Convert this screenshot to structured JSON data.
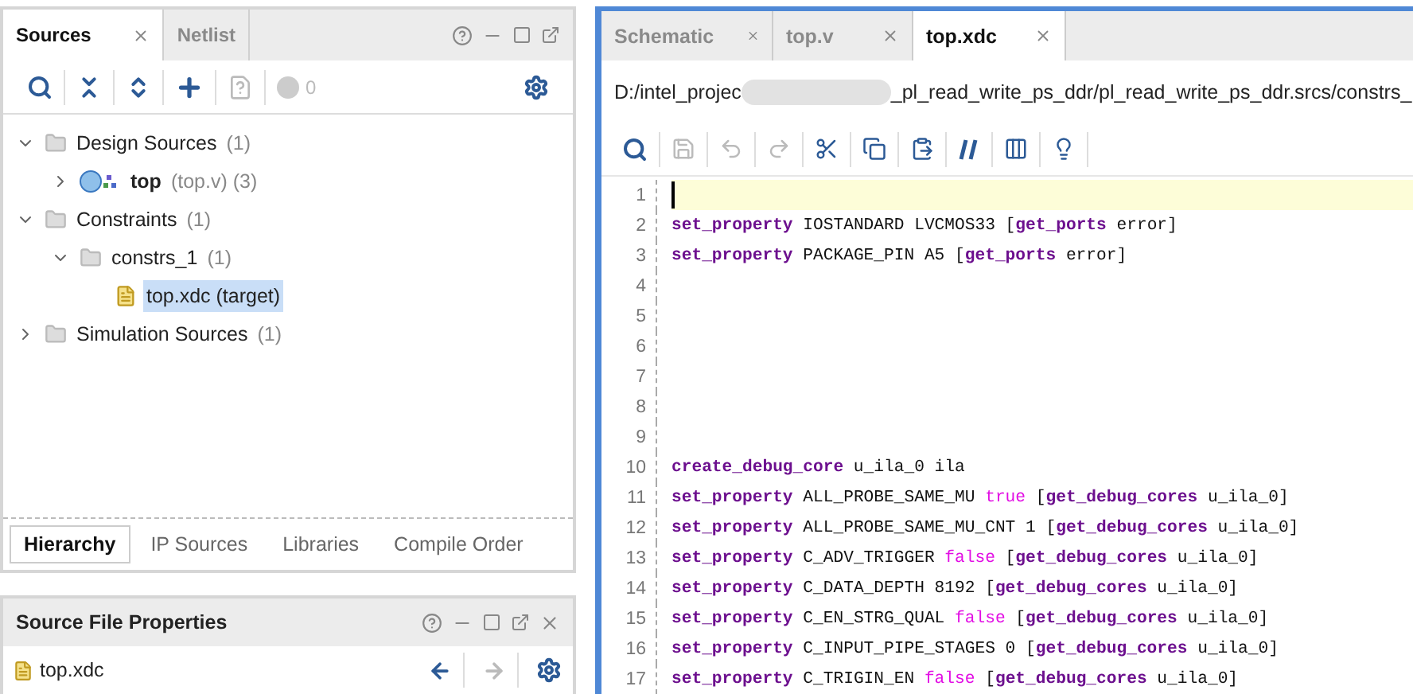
{
  "sources_panel": {
    "tabs": [
      {
        "label": "Sources",
        "selected": true,
        "closable": true
      },
      {
        "label": "Netlist",
        "selected": false,
        "closable": false
      }
    ],
    "issue_count": "0",
    "tree": [
      {
        "kind": "folder",
        "label": "Design Sources",
        "count": "(1)",
        "expanded": true,
        "selected": false,
        "children": [
          {
            "kind": "module",
            "label": "top",
            "count": "(top.v) (3)",
            "expanded": false,
            "selected": false
          }
        ]
      },
      {
        "kind": "folder",
        "label": "Constraints",
        "count": "(1)",
        "expanded": true,
        "selected": false,
        "children": [
          {
            "kind": "folder",
            "label": "constrs_1",
            "count": "(1)",
            "expanded": true,
            "selected": false,
            "children": [
              {
                "kind": "file",
                "label": "top.xdc (target)",
                "selected": true
              }
            ]
          }
        ]
      },
      {
        "kind": "folder",
        "label": "Simulation Sources",
        "count": "(1)",
        "expanded": false,
        "selected": false
      }
    ],
    "bottom_tabs": [
      {
        "label": "Hierarchy",
        "selected": true
      },
      {
        "label": "IP Sources",
        "selected": false
      },
      {
        "label": "Libraries",
        "selected": false
      },
      {
        "label": "Compile Order",
        "selected": false
      }
    ]
  },
  "properties_panel": {
    "title": "Source File Properties",
    "file": "top.xdc"
  },
  "editor": {
    "tabs": [
      {
        "label": "Schematic",
        "selected": false
      },
      {
        "label": "top.v",
        "selected": false
      },
      {
        "label": "top.xdc",
        "selected": true
      }
    ],
    "path_start": "D:/intel_projec",
    "path_end": "_pl_read_write_ps_ddr/pl_read_write_ps_ddr.srcs/constrs_",
    "lines": [
      {
        "number": "1",
        "current": true
      },
      {
        "number": "2",
        "current": false,
        "tokens": [
          {
            "kind": "keyword",
            "text": "set_property"
          },
          {
            "kind": "plain",
            "text": " IOSTANDARD LVCMOS33 ["
          },
          {
            "kind": "keyword",
            "text": "get_ports"
          },
          {
            "kind": "plain",
            "text": " error]"
          }
        ]
      },
      {
        "number": "3",
        "current": false,
        "tokens": [
          {
            "kind": "keyword",
            "text": "set_property"
          },
          {
            "kind": "plain",
            "text": " PACKAGE_PIN A5 ["
          },
          {
            "kind": "keyword",
            "text": "get_ports"
          },
          {
            "kind": "plain",
            "text": " error]"
          }
        ]
      },
      {
        "number": "4",
        "current": false
      },
      {
        "number": "5",
        "current": false
      },
      {
        "number": "6",
        "current": false
      },
      {
        "number": "7",
        "current": false
      },
      {
        "number": "8",
        "current": false
      },
      {
        "number": "9",
        "current": false
      },
      {
        "number": "10",
        "current": false,
        "tokens": [
          {
            "kind": "keyword",
            "text": "create_debug_core"
          },
          {
            "kind": "plain",
            "text": " u_ila_0 ila"
          }
        ]
      },
      {
        "number": "11",
        "current": false,
        "tokens": [
          {
            "kind": "keyword",
            "text": "set_property"
          },
          {
            "kind": "plain",
            "text": " ALL_PROBE_SAME_MU "
          },
          {
            "kind": "literal",
            "text": "true"
          },
          {
            "kind": "plain",
            "text": " ["
          },
          {
            "kind": "keyword",
            "text": "get_debug_cores"
          },
          {
            "kind": "plain",
            "text": " u_ila_0]"
          }
        ]
      },
      {
        "number": "12",
        "current": false,
        "tokens": [
          {
            "kind": "keyword",
            "text": "set_property"
          },
          {
            "kind": "plain",
            "text": " ALL_PROBE_SAME_MU_CNT 1 ["
          },
          {
            "kind": "keyword",
            "text": "get_debug_cores"
          },
          {
            "kind": "plain",
            "text": " u_ila_0]"
          }
        ]
      },
      {
        "number": "13",
        "current": false,
        "tokens": [
          {
            "kind": "keyword",
            "text": "set_property"
          },
          {
            "kind": "plain",
            "text": " C_ADV_TRIGGER "
          },
          {
            "kind": "literal",
            "text": "false"
          },
          {
            "kind": "plain",
            "text": " ["
          },
          {
            "kind": "keyword",
            "text": "get_debug_cores"
          },
          {
            "kind": "plain",
            "text": " u_ila_0]"
          }
        ]
      },
      {
        "number": "14",
        "current": false,
        "tokens": [
          {
            "kind": "keyword",
            "text": "set_property"
          },
          {
            "kind": "plain",
            "text": " C_DATA_DEPTH 8192 ["
          },
          {
            "kind": "keyword",
            "text": "get_debug_cores"
          },
          {
            "kind": "plain",
            "text": " u_ila_0]"
          }
        ]
      },
      {
        "number": "15",
        "current": false,
        "tokens": [
          {
            "kind": "keyword",
            "text": "set_property"
          },
          {
            "kind": "plain",
            "text": " C_EN_STRG_QUAL "
          },
          {
            "kind": "literal",
            "text": "false"
          },
          {
            "kind": "plain",
            "text": " ["
          },
          {
            "kind": "keyword",
            "text": "get_debug_cores"
          },
          {
            "kind": "plain",
            "text": " u_ila_0]"
          }
        ]
      },
      {
        "number": "16",
        "current": false,
        "tokens": [
          {
            "kind": "keyword",
            "text": "set_property"
          },
          {
            "kind": "plain",
            "text": " C_INPUT_PIPE_STAGES 0 ["
          },
          {
            "kind": "keyword",
            "text": "get_debug_cores"
          },
          {
            "kind": "plain",
            "text": " u_ila_0]"
          }
        ]
      },
      {
        "number": "17",
        "current": false,
        "tokens": [
          {
            "kind": "keyword",
            "text": "set_property"
          },
          {
            "kind": "plain",
            "text": " C_TRIGIN_EN "
          },
          {
            "kind": "literal",
            "text": "false"
          },
          {
            "kind": "plain",
            "text": " ["
          },
          {
            "kind": "keyword",
            "text": "get_debug_cores"
          },
          {
            "kind": "plain",
            "text": " u_ila_0]"
          }
        ]
      }
    ]
  }
}
